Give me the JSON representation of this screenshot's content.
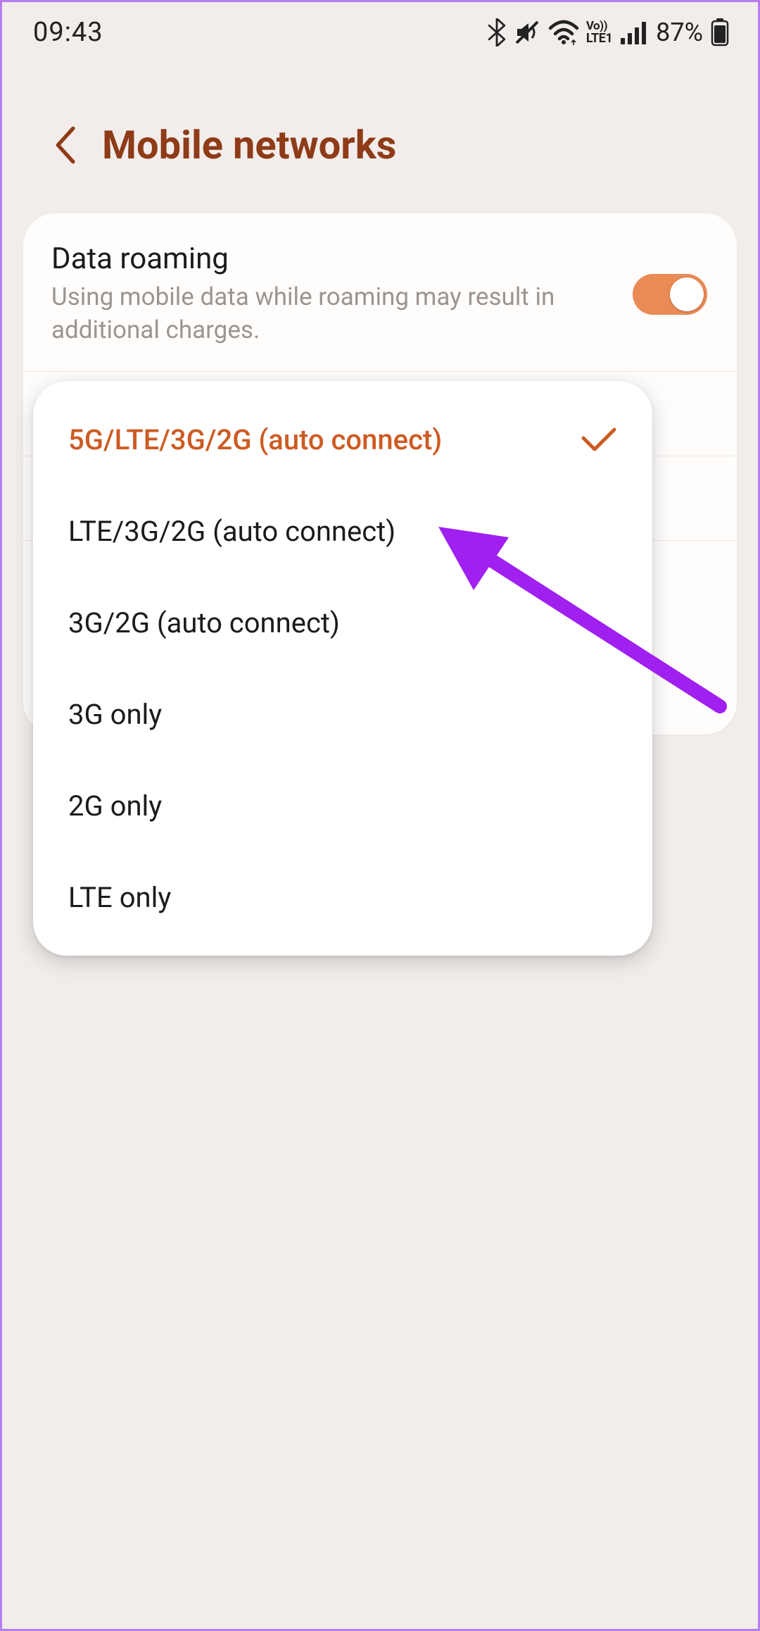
{
  "statusbar": {
    "time": "09:43",
    "battery_percent": "87%",
    "volte_line1": "Vo))",
    "volte_line2": "LTE1"
  },
  "header": {
    "title": "Mobile networks"
  },
  "settings": {
    "data_roaming": {
      "title": "Data roaming",
      "desc": "Using mobile data while roaming may result in additional charges.",
      "enabled": true
    }
  },
  "network_mode_options": [
    "5G/LTE/3G/2G (auto connect)",
    "LTE/3G/2G (auto connect)",
    "3G/2G (auto connect)",
    "3G only",
    "2G only",
    "LTE only"
  ],
  "network_mode_selected_index": 0,
  "colors": {
    "accent": "#cd5b22",
    "header": "#8e3b17",
    "switch_on": "#ea8a55",
    "annotation": "#a020f0"
  }
}
